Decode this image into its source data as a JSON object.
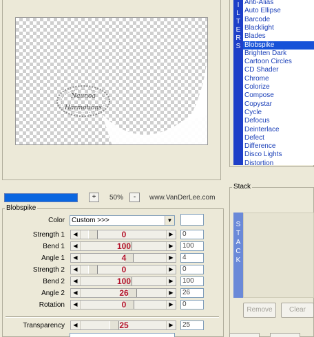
{
  "filters": {
    "tab_letters": [
      "I",
      "L",
      "T",
      "E",
      "R",
      "S"
    ],
    "items": [
      "Anti-Alias",
      "Auto Ellipse",
      "Barcode",
      "Blacklight",
      "Blades",
      "Blobspike",
      "Brighten Dark",
      "Cartoon Circles",
      "CD Shader",
      "Chrome",
      "Colorize",
      "Compose",
      "Copystar",
      "Cycle",
      "Defocus",
      "Deinterlace",
      "Defect",
      "Difference",
      "Disco Lights",
      "Distortion"
    ],
    "selected": "Blobspike"
  },
  "preview": {
    "watermark_line1": "Naunoa",
    "watermark_line2": "Harmotions"
  },
  "toolbar": {
    "progress": 1.0,
    "zoom_in": "+",
    "zoom": "50%",
    "zoom_out": "-",
    "website": "www.VanDerLee.com"
  },
  "settings": {
    "group_title": "Blobspike",
    "color_label": "Color",
    "color_value": "Custom >>>",
    "swatch_color": "#ffffff",
    "sliders": [
      {
        "label": "Strength 1",
        "display": "0",
        "box": "0",
        "pos": 0.1
      },
      {
        "label": "Bend 1",
        "display": "100",
        "box": "100",
        "pos": 0.55
      },
      {
        "label": "Angle 1",
        "display": "4",
        "box": "4",
        "pos": 0.57
      },
      {
        "label": "Strength 2",
        "display": "0",
        "box": "0",
        "pos": 0.1
      },
      {
        "label": "Bend 2",
        "display": "100",
        "box": "100",
        "pos": 0.55
      },
      {
        "label": "Angle 2",
        "display": "26",
        "box": "26",
        "pos": 0.62
      },
      {
        "label": "Rotation",
        "display": "0",
        "box": "0",
        "pos": 0.58
      }
    ],
    "transparency": {
      "label": "Transparency",
      "display": "25",
      "box": "25",
      "pos": 0.38
    }
  },
  "stack": {
    "title": "Stack",
    "tab_letters": [
      "S",
      "T",
      "A",
      "C",
      "K"
    ],
    "remove": "Remove",
    "clear": "Clear"
  },
  "colors": {
    "selection": "#1652d8",
    "value_red": "#b3122a",
    "tab_blue": "#1e3fc8"
  }
}
